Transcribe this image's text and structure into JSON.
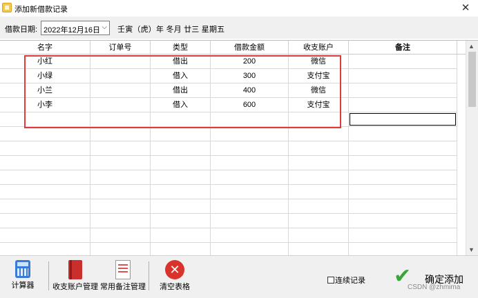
{
  "window": {
    "title": "添加新借款记录",
    "close_glyph": "✕"
  },
  "datebar": {
    "label": "借款日期:",
    "date_value": "2022年12月16日",
    "lunar_text": "壬寅（虎）年 冬月 廿三 星期五"
  },
  "grid": {
    "columns": [
      "名字",
      "订单号",
      "类型",
      "借款金额",
      "收支账户",
      "备注"
    ],
    "rows": [
      {
        "name": "小红",
        "order": "",
        "type": "借出",
        "amount": "200",
        "account": "微信",
        "note": ""
      },
      {
        "name": "小绿",
        "order": "",
        "type": "借入",
        "amount": "300",
        "account": "支付宝",
        "note": ""
      },
      {
        "name": "小兰",
        "order": "",
        "type": "借出",
        "amount": "400",
        "account": "微信",
        "note": ""
      },
      {
        "name": "小李",
        "order": "",
        "type": "借入",
        "amount": "600",
        "account": "支付宝",
        "note": ""
      }
    ],
    "highlight_color": "#e03a3a"
  },
  "toolbar": {
    "calculator_label": "计算器",
    "accounts_label": "收支账户管理",
    "notes_label": "常用备注管理",
    "clear_label": "清空表格",
    "continuous_label": "连续记录",
    "continuous_checked": false,
    "ok_label": "确定添加"
  },
  "watermark": "CSDN @zhmima"
}
